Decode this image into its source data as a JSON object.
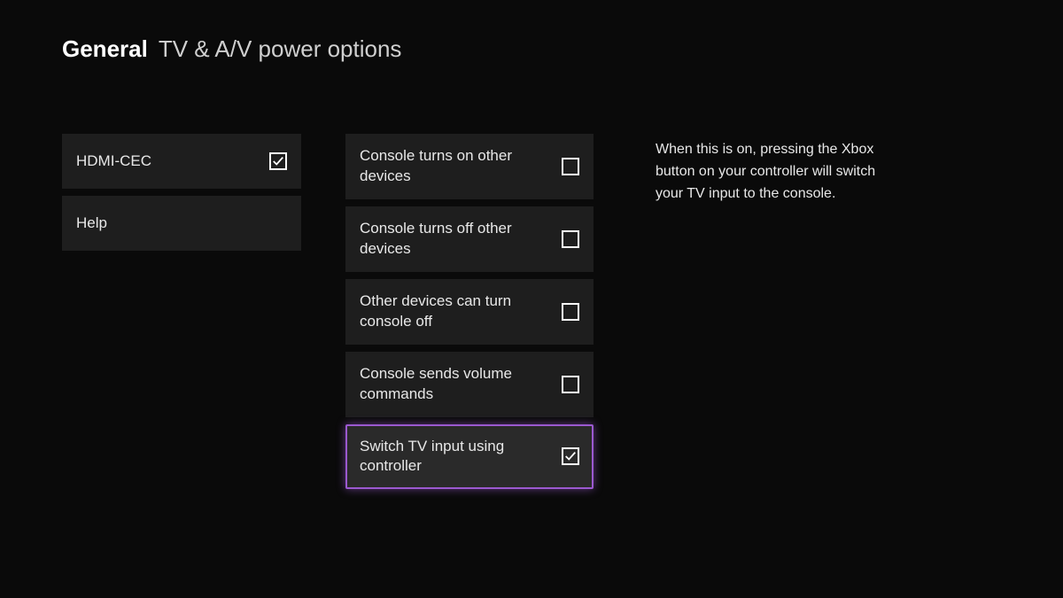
{
  "header": {
    "category": "General",
    "title": "TV & A/V power options"
  },
  "left": [
    {
      "label": "HDMI-CEC",
      "checked": true,
      "hasCheckbox": true
    },
    {
      "label": "Help",
      "checked": false,
      "hasCheckbox": false
    }
  ],
  "options": [
    {
      "label": "Console turns on other devices",
      "checked": false,
      "selected": false
    },
    {
      "label": "Console turns off other devices",
      "checked": false,
      "selected": false
    },
    {
      "label": "Other devices can turn console off",
      "checked": false,
      "selected": false
    },
    {
      "label": "Console sends volume commands",
      "checked": false,
      "selected": false
    },
    {
      "label": "Switch TV input using controller",
      "checked": true,
      "selected": true
    }
  ],
  "description": "When this is on, pressing the Xbox button on your controller will switch your TV input to the console."
}
